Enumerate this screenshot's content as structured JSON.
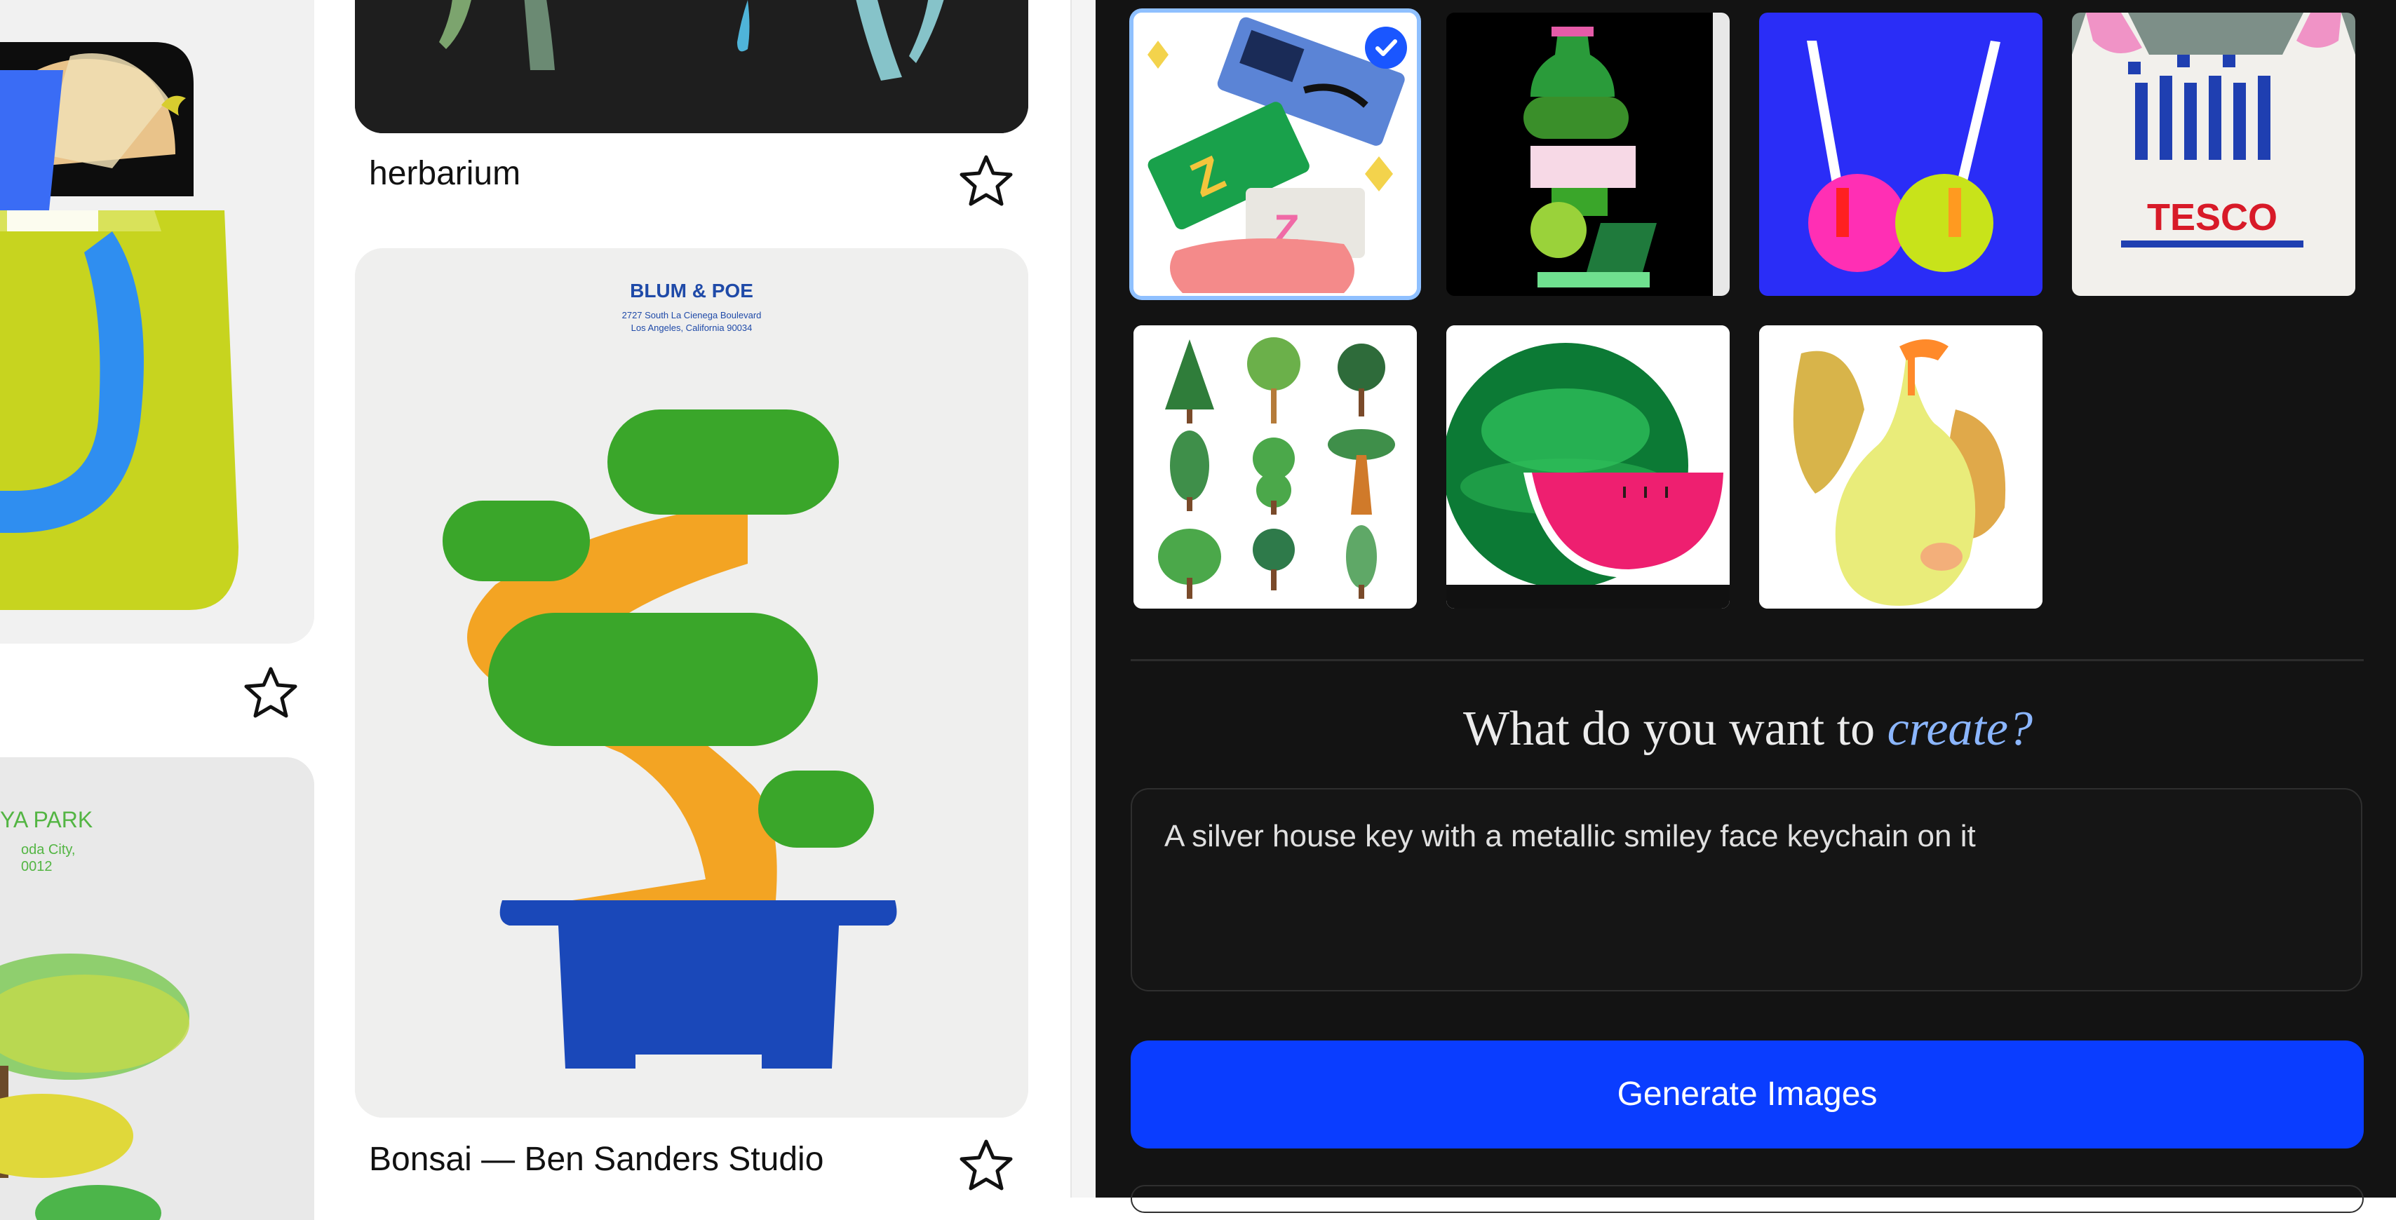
{
  "gallery": {
    "cards": [
      {
        "caption": "herbarium",
        "favorite_icon": "star-outline-icon"
      },
      {
        "caption": "Bonsai — Ben Sanders Studio",
        "favorite_icon": "star-outline-icon"
      }
    ],
    "partial_card_star_icon": "star-outline-icon",
    "poster": {
      "bonsai_header": "BLUM & POE",
      "bonsai_address_1": "2727 South La Cienega Boulevard",
      "bonsai_address_2": "Los Angeles, California 90034",
      "park_title": "YA PARK",
      "park_line_1": "oda City,",
      "park_line_2": "0012"
    }
  },
  "style_picker": {
    "thumbnails": [
      {
        "name": "tickets",
        "selected": true,
        "check_icon": "checkmark-icon"
      },
      {
        "name": "bottle-stack",
        "selected": false
      },
      {
        "name": "blue-bikini",
        "selected": false
      },
      {
        "name": "tesco-bag",
        "selected": false,
        "label": "TESCO"
      },
      {
        "name": "trees",
        "selected": false
      },
      {
        "name": "watermelon",
        "selected": false
      },
      {
        "name": "pear",
        "selected": false
      }
    ]
  },
  "create": {
    "heading_prefix": "What do you want to ",
    "heading_accent": "create?",
    "prompt_value": "A silver house key with a metallic smiley face keychain on it",
    "generate_label": "Generate Images"
  },
  "colors": {
    "panel_bg": "#131313",
    "accent_blue": "#0a3dff",
    "heading_accent": "#8bb6ff",
    "selected_border": "#8fc0ff"
  }
}
